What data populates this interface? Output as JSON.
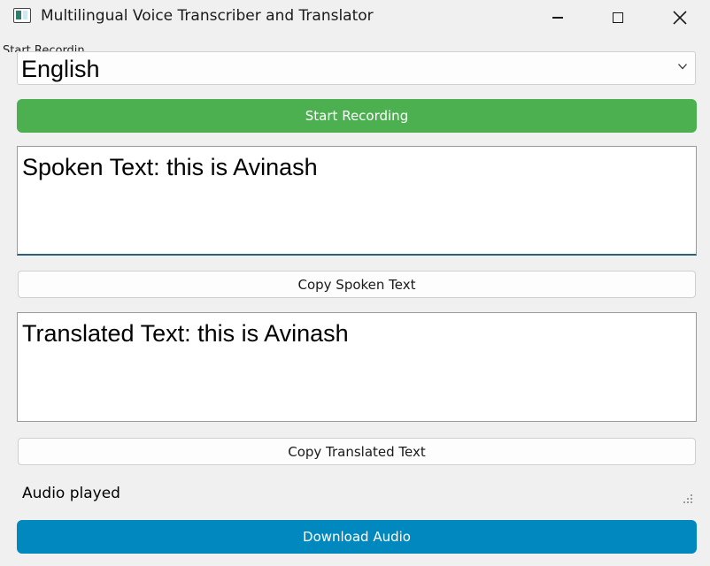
{
  "window": {
    "title": "Multilingual Voice Transcriber and Translator",
    "icon": "app-icon"
  },
  "clipped_label": "Start Recordin",
  "language": {
    "selected": "English",
    "icon": "chevron-down-icon"
  },
  "buttons": {
    "start_recording": "Start Recording",
    "copy_spoken": "Copy Spoken Text",
    "copy_translated": "Copy Translated Text",
    "download_audio": "Download Audio"
  },
  "spoken_text": "Spoken Text: this is Avinash",
  "translated_text": "Translated Text: this is Avinash",
  "status": "Audio played",
  "colors": {
    "start_button": "#4caf50",
    "download_button": "#0088bf"
  }
}
